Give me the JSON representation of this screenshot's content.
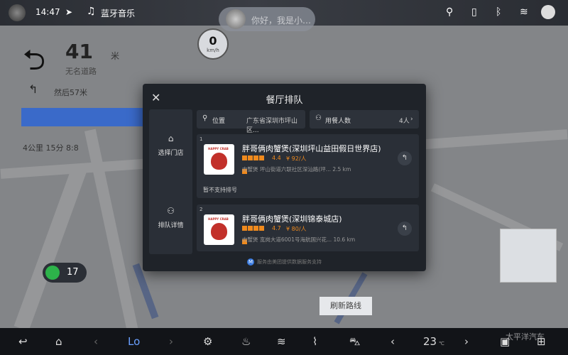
{
  "status_bar": {
    "time": "14:47",
    "music_source": "蓝牙音乐",
    "voice_hint": "你好，我是小…"
  },
  "navigation": {
    "distance_value": "41",
    "distance_unit": "米",
    "current_road": "无名道路",
    "next_instruction": "然后57米",
    "speed_limit": "0",
    "speed_unit": "km/h",
    "trip_summary": "4公里  15分  8:8",
    "congestion_count": "17",
    "map_button_label": "刷新路线"
  },
  "modal": {
    "title": "餐厅排队",
    "sidebar": [
      {
        "icon": "home-icon",
        "label": "选择门店"
      },
      {
        "icon": "people-icon",
        "label": "排队详情"
      }
    ],
    "filters": {
      "location_label": "位置",
      "location_value": "广东省深圳市坪山区...",
      "party_label": "用餐人数",
      "party_value": "4人"
    },
    "restaurants": [
      {
        "index": "1",
        "name": "胖哥俩肉蟹煲(深圳坪山益田假日世界店)",
        "rating": "4.4",
        "price": "¥ 92/人",
        "stars": 5,
        "description": "肉蟹煲  坪山街道六联社区深汕路(坪...  2.5 km",
        "note": "暂不支持排号"
      },
      {
        "index": "2",
        "name": "胖哥俩肉蟹煲(深圳锦泰城店)",
        "rating": "4.7",
        "price": "¥ 80/人",
        "stars": 5,
        "description": "肉蟹煲  宽岗大道6001号海航国兴花...  10.6 km",
        "note": ""
      }
    ],
    "footer": "服务由美团提供数据服务支持"
  },
  "dock": {
    "climate_left": "Lo",
    "climate_right": "23",
    "climate_unit": "℃"
  },
  "watermark": "太平洋汽车",
  "colors": {
    "accent_orange": "#f08a1d",
    "modal_bg": "#1f2329",
    "card_bg": "#2a2f37",
    "lane_blue": "#3a6ac9",
    "congestion_green": "#2db34a"
  }
}
